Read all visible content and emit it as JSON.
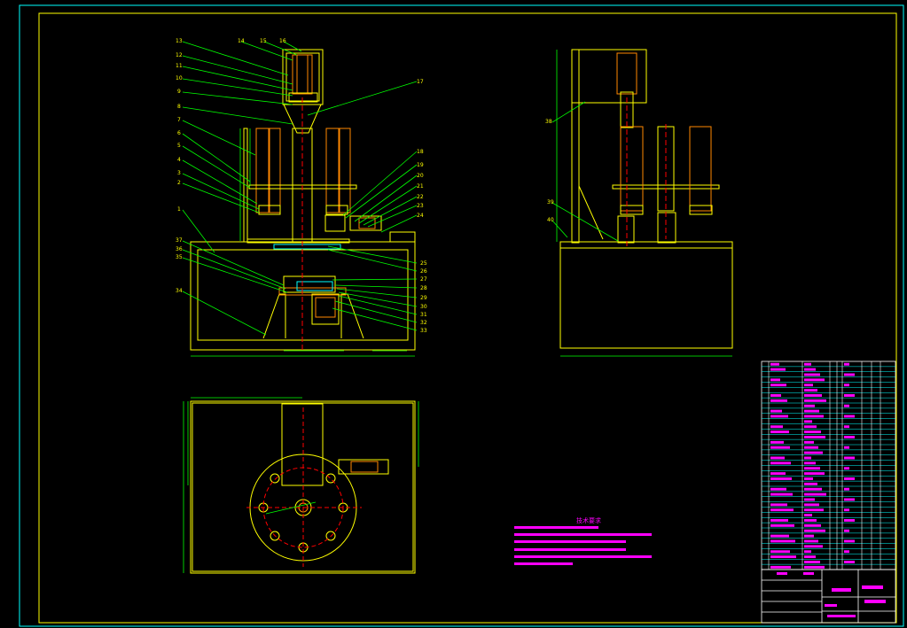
{
  "colors": {
    "background": "#000000",
    "border": "#00ffff",
    "frame": "#ffff00",
    "leader": "#00ff00",
    "part": "#ffff00",
    "centerline": "#ff0000",
    "dimension": "#00ff00",
    "accent": "#ff00ff",
    "edge": "#ffffff"
  },
  "balloons": {
    "front_left": [
      "13",
      "12",
      "11",
      "10",
      "9",
      "8",
      "7",
      "6",
      "5",
      "4",
      "3",
      "2",
      "1",
      "37",
      "36",
      "35",
      "34"
    ],
    "front_top": [
      "14",
      "15",
      "16"
    ],
    "front_right": [
      "17",
      "18",
      "19",
      "20",
      "21",
      "22",
      "23",
      "24",
      "25",
      "26",
      "27",
      "28",
      "29",
      "30",
      "31",
      "32",
      "33"
    ],
    "side_left": [
      "38",
      "39",
      "40"
    ]
  },
  "technical_requirements": {
    "title": "技术要求"
  }
}
